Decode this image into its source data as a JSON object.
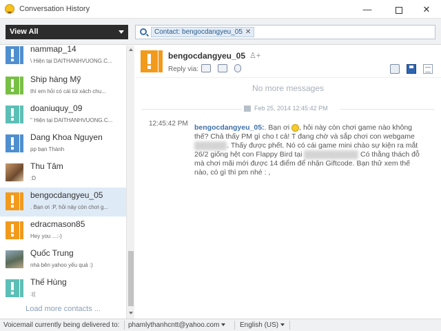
{
  "window": {
    "title": "Conversation History",
    "controls": {
      "minimize": "—",
      "close": "✕"
    }
  },
  "toolbar": {
    "view_filter": "View All",
    "contact_chip": "Contact: bengocdangyeu_05",
    "chip_close": "✕"
  },
  "contacts": [
    {
      "name": "nammap_14",
      "snippet": "\\ Hiện tại DAITHANHVUONG.C...",
      "icon": "orange-contact-icon"
    },
    {
      "name": "Ship hàng Mỹ",
      "snippet": "thì em hỏi có cái túi xách chu...",
      "icon": "green-contact-icon"
    },
    {
      "name": "doaniuquy_09",
      "snippet": "\" Hiện tại DAITHANHVUONG.C...",
      "icon": "teal-contact-icon"
    },
    {
      "name": "Dang Khoa Nguyen",
      "snippet": "pp bạn Thành",
      "icon": "blue-contact-icon"
    },
    {
      "name": "Thu Tâm",
      "snippet": ":D",
      "icon": "photo-avatar"
    },
    {
      "name": "bengocdangyeu_05",
      "snippet": ". Bạn ơi :P, hỏi này còn chơi g...",
      "icon": "orange-contact-icon",
      "selected": true
    },
    {
      "name": "edracmason85",
      "snippet": "Hey you ...:-)",
      "icon": "orange-contact-icon"
    },
    {
      "name": "Quốc Trung",
      "snippet": "nhà bên yahoo yếu quá :)",
      "icon": "photo-avatar"
    },
    {
      "name": "Thế Hùng",
      "snippet": ":((",
      "icon": "teal-contact-icon"
    }
  ],
  "load_more": "Load more contacts ...",
  "conversation": {
    "contact_name": "bengocdangyeu_05",
    "reply_via": "Reply via:",
    "no_more": "No more messages",
    "date_stamp": "Feb 25, 2014 12:45:42 PM",
    "message": {
      "time": "12:45:42 PM",
      "sender": "bengocdangyeu_05:",
      "text_1": ". Bạn ơi ",
      "text_2": ", hỏi này còn chơi game nào không thế? Chả thấy PM gì cho t cả! T đang chờ và sắp chơi con webgame ",
      "text_3": ". Thấy được phết. Nó có cái game mini chào sự kiện ra mắt 26/2 giống hệt con Flappy Bird tại ",
      "text_4": " Có thằng thách đỗ mà chơi mãi mới được 14 điểm để nhận Giftcode. Bạn thử xem thế nào, có gì thì pm nhé : ,"
    }
  },
  "status_bar": {
    "voicemail_label": "Voicemail currently being delivered to:",
    "email": "phamlythanhcntt@yahoo.com",
    "language": "English (US)"
  },
  "colors": {
    "accent_blue": "#3f6fa8",
    "selected_row": "#dfeaf7",
    "view_select_bg": "#2c2c2c",
    "orange_icon": "#f29a1c",
    "green_icon": "#78c043",
    "teal_icon": "#5cbfb6",
    "blue_icon": "#4f8fcf"
  }
}
